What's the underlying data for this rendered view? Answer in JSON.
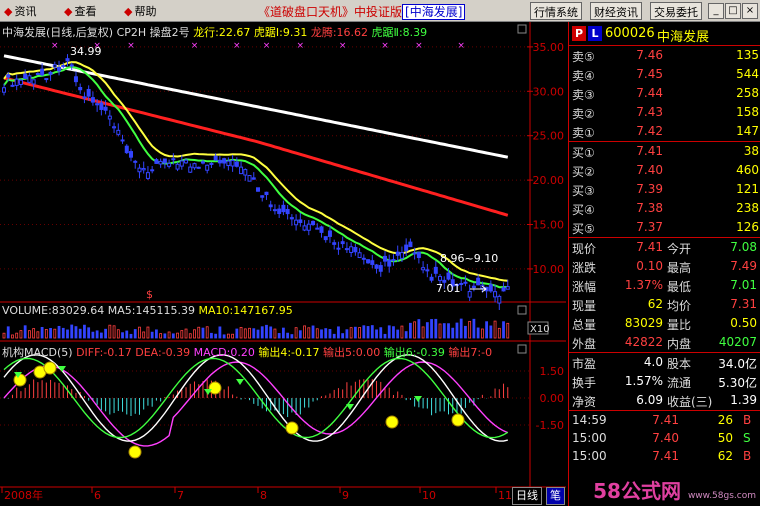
{
  "topbar": {
    "menus": [
      "资讯",
      "查看",
      "帮助"
    ],
    "title_main": "《道破盘口天机》中投证版",
    "title_brand": "[中海发展]",
    "buttons": [
      "行情系统",
      "财经资讯",
      "交易委托"
    ],
    "window_buttons": [
      "_",
      "□",
      "×"
    ]
  },
  "kline_info": {
    "name": "中海发展(日线,后复权)",
    "indicator": "CP2H 操盘2号",
    "longxing": "龙行:22.67",
    "huju1": "虎踞Ⅰ:9.31",
    "longteng": "龙腾:16.62",
    "huju2": "虎踞Ⅱ:8.39"
  },
  "volume_info": {
    "vol": "VOLUME:83029.64",
    "ma5": "MA5:145115.39",
    "ma10": "MA10:147167.95",
    "multiplier": "X10"
  },
  "macd_info": {
    "name": "机构MACD(5)",
    "diff": "DIFF:-0.17",
    "dea": "DEA:-0.39",
    "macd": "MACD:0.20",
    "out4": "输出4:-0.17",
    "out5": "输出5:0.00",
    "out6": "输出6:-0.39",
    "out7": "输出7:-0"
  },
  "price_axis": [
    "35.00",
    "30.00",
    "25.00",
    "20.00",
    "15.00",
    "10.00"
  ],
  "macd_axis": [
    "1.50",
    "0.00",
    "-1.50"
  ],
  "date_axis": [
    "2008年",
    "6",
    "7",
    "8",
    "9",
    "10",
    "11"
  ],
  "annotations": {
    "high": "34.99",
    "mid": "8.96~9.10",
    "low": "7.01",
    "signal": "$"
  },
  "stock": {
    "p": "P",
    "l": "L",
    "code": "600026",
    "name": "中海发展"
  },
  "asks": [
    {
      "label": "卖⑤",
      "price": "7.46",
      "vol": "135"
    },
    {
      "label": "卖④",
      "price": "7.45",
      "vol": "544"
    },
    {
      "label": "卖③",
      "price": "7.44",
      "vol": "258"
    },
    {
      "label": "卖②",
      "price": "7.43",
      "vol": "158"
    },
    {
      "label": "卖①",
      "price": "7.42",
      "vol": "147"
    }
  ],
  "bids": [
    {
      "label": "买①",
      "price": "7.41",
      "vol": "38"
    },
    {
      "label": "买②",
      "price": "7.40",
      "vol": "460"
    },
    {
      "label": "买③",
      "price": "7.39",
      "vol": "121"
    },
    {
      "label": "买④",
      "price": "7.38",
      "vol": "238"
    },
    {
      "label": "买⑤",
      "price": "7.37",
      "vol": "126"
    }
  ],
  "quote": [
    {
      "l1": "现价",
      "v1": "7.41",
      "c1": "#ff4040",
      "l2": "今开",
      "v2": "7.08",
      "c2": "#40ff40"
    },
    {
      "l1": "涨跌",
      "v1": "0.10",
      "c1": "#ff4040",
      "l2": "最高",
      "v2": "7.49",
      "c2": "#ff4040"
    },
    {
      "l1": "涨幅",
      "v1": "1.37%",
      "c1": "#ff4040",
      "l2": "最低",
      "v2": "7.01",
      "c2": "#40ff40"
    },
    {
      "l1": "现量",
      "v1": "62",
      "c1": "#ff0",
      "l2": "均价",
      "v2": "7.31",
      "c2": "#ff4040"
    },
    {
      "l1": "总量",
      "v1": "83029",
      "c1": "#ff0",
      "l2": "量比",
      "v2": "0.50",
      "c2": "#ff0"
    },
    {
      "l1": "外盘",
      "v1": "42822",
      "c1": "#ff4040",
      "l2": "内盘",
      "v2": "40207",
      "c2": "#40ff40"
    }
  ],
  "quote2": [
    {
      "l1": "市盈",
      "v1": "4.0",
      "l2": "股本",
      "v2": "34.0亿"
    },
    {
      "l1": "换手",
      "v1": "1.57%",
      "l2": "流通",
      "v2": "5.30亿"
    },
    {
      "l1": "净资",
      "v1": "6.09",
      "l2": "收益(三)",
      "v2": "1.39"
    }
  ],
  "ticks": [
    {
      "time": "14:59",
      "price": "7.41",
      "vol": "26",
      "dir": "B",
      "pc": "#ff4040",
      "dc": "#ff4040"
    },
    {
      "time": "15:00",
      "price": "7.40",
      "vol": "50",
      "dir": "S",
      "pc": "#ff4040",
      "dc": "#40ff40"
    },
    {
      "time": "15:00",
      "price": "7.41",
      "vol": "62",
      "dir": "B",
      "pc": "#ff4040",
      "dc": "#ff4040"
    }
  ],
  "bottom": {
    "tab1": "日线",
    "tab2": "笔"
  },
  "watermark": {
    "main": "58公式网",
    "sub": "www.58gs.com"
  },
  "colors": {
    "up": "#ff4040",
    "down": "#40ff40",
    "candle": "#3344ff",
    "ma_white": "#ffffff",
    "ma_red": "#ff2020",
    "ma_yellow": "#ffff40",
    "ma_green": "#40ff40",
    "macd_white": "#ffffff",
    "macd_purple": "#ff40ff"
  }
}
